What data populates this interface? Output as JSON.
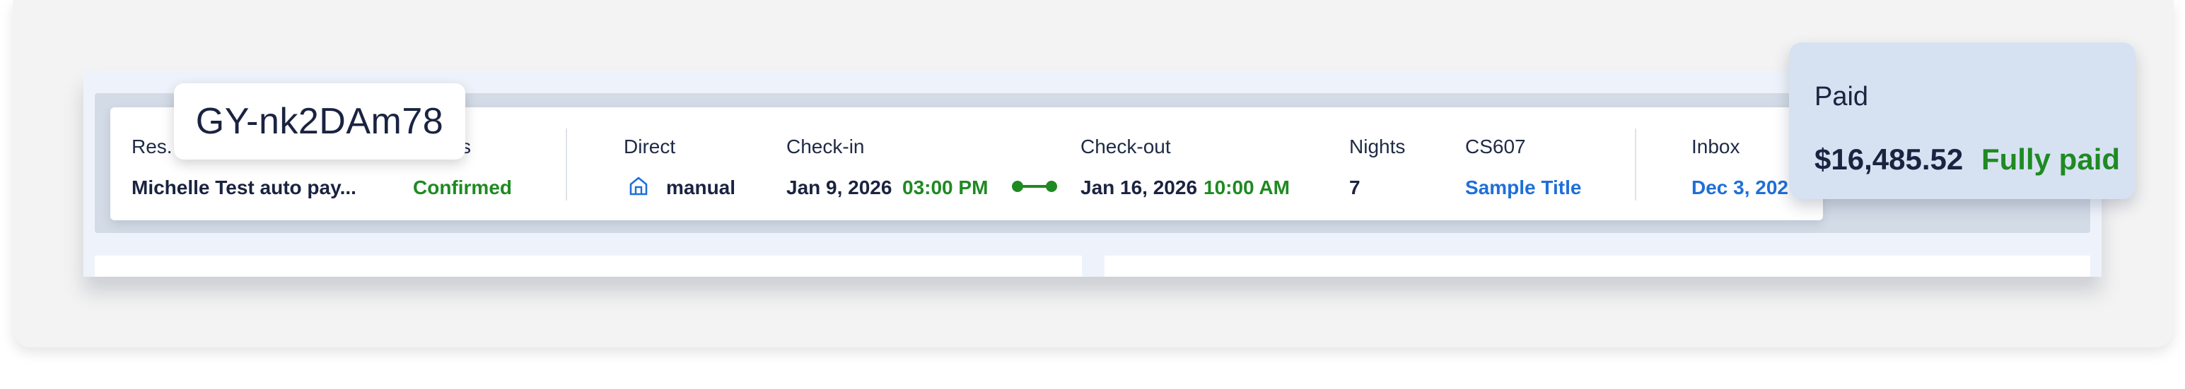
{
  "tooltip": {
    "text": "GY-nk2DAm78"
  },
  "reservation": {
    "res_label": "Res.",
    "status_label_tail": "s",
    "guest_name": "Michelle Test auto pay...",
    "status": "Confirmed",
    "channel_label": "Direct",
    "channel_value": "manual",
    "checkin_label": "Check-in",
    "checkin_date": "Jan 9, 2026",
    "checkin_time": "03:00 PM",
    "checkout_label": "Check-out",
    "checkout_date": "Jan 16, 2026",
    "checkout_time": "10:00 AM",
    "nights_label": "Nights",
    "nights_value": "7",
    "listing_label": "CS607",
    "listing_value": "Sample Title",
    "inbox_label": "Inbox",
    "inbox_value": "Dec 3, 202"
  },
  "payment": {
    "title": "Paid",
    "amount": "$16,485.52",
    "status": "Fully paid"
  },
  "colors": {
    "accent_green": "#1f8a22",
    "accent_blue": "#1f6fd8",
    "text_dark": "#1a2340"
  },
  "icons": {
    "channel": "house-icon",
    "stay": "timeline-connector-icon"
  }
}
